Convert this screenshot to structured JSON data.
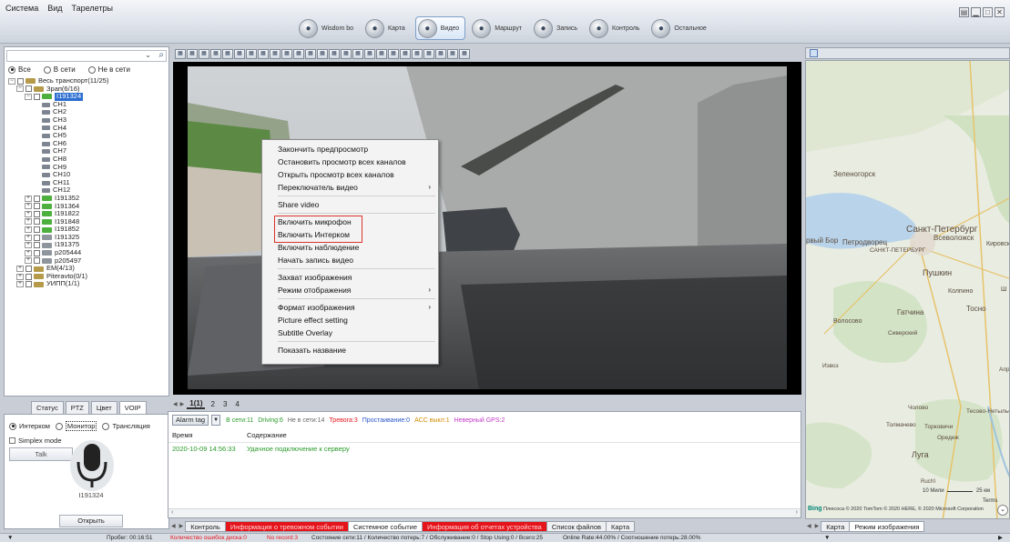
{
  "menu": [
    "Система",
    "Вид",
    "Тарелетры"
  ],
  "nav": [
    {
      "label": "Wisdom bo",
      "icon": "wisdom-icon",
      "active": false
    },
    {
      "label": "Карта",
      "icon": "map-icon",
      "active": false
    },
    {
      "label": "Видео",
      "icon": "video-icon",
      "active": true
    },
    {
      "label": "Маршрут",
      "icon": "route-icon",
      "active": false
    },
    {
      "label": "Запись",
      "icon": "record-icon",
      "active": false
    },
    {
      "label": "Контроль",
      "icon": "control-icon",
      "active": false
    },
    {
      "label": "Остальное",
      "icon": "other-icon",
      "active": false
    }
  ],
  "filter": {
    "all": "Все",
    "online": "В сети",
    "offline": "Не в сети"
  },
  "tree": [
    {
      "indent": 0,
      "exp": "−",
      "kind": "grp",
      "label": "Весь транспорт(11/25)"
    },
    {
      "indent": 1,
      "exp": "−",
      "kind": "grp",
      "label": "Зрап(6/16)"
    },
    {
      "indent": 2,
      "exp": "−",
      "kind": "grn",
      "label": "I191324",
      "selected": true
    },
    {
      "indent": 3,
      "exp": "",
      "kind": "cam",
      "label": "CH1"
    },
    {
      "indent": 3,
      "exp": "",
      "kind": "cam",
      "label": "CH2"
    },
    {
      "indent": 3,
      "exp": "",
      "kind": "cam",
      "label": "CH3"
    },
    {
      "indent": 3,
      "exp": "",
      "kind": "cam",
      "label": "CH4"
    },
    {
      "indent": 3,
      "exp": "",
      "kind": "cam",
      "label": "CH5"
    },
    {
      "indent": 3,
      "exp": "",
      "kind": "cam",
      "label": "CH6"
    },
    {
      "indent": 3,
      "exp": "",
      "kind": "cam",
      "label": "CH7"
    },
    {
      "indent": 3,
      "exp": "",
      "kind": "cam",
      "label": "CH8"
    },
    {
      "indent": 3,
      "exp": "",
      "kind": "cam",
      "label": "CH9"
    },
    {
      "indent": 3,
      "exp": "",
      "kind": "cam",
      "label": "CH10"
    },
    {
      "indent": 3,
      "exp": "",
      "kind": "cam",
      "label": "CH11"
    },
    {
      "indent": 3,
      "exp": "",
      "kind": "cam",
      "label": "CH12"
    },
    {
      "indent": 2,
      "exp": "+",
      "kind": "grn",
      "label": "I191352"
    },
    {
      "indent": 2,
      "exp": "+",
      "kind": "grn",
      "label": "I191364"
    },
    {
      "indent": 2,
      "exp": "+",
      "kind": "grn",
      "label": "I191822"
    },
    {
      "indent": 2,
      "exp": "+",
      "kind": "grn",
      "label": "I191848"
    },
    {
      "indent": 2,
      "exp": "+",
      "kind": "grn",
      "label": "I191852"
    },
    {
      "indent": 2,
      "exp": "+",
      "kind": "gry",
      "label": "I191325"
    },
    {
      "indent": 2,
      "exp": "+",
      "kind": "gry",
      "label": "I191375"
    },
    {
      "indent": 2,
      "exp": "+",
      "kind": "gry",
      "label": "p205444"
    },
    {
      "indent": 2,
      "exp": "+",
      "kind": "gry",
      "label": "p205497"
    },
    {
      "indent": 1,
      "exp": "+",
      "kind": "grp",
      "label": "EM(4/13)"
    },
    {
      "indent": 1,
      "exp": "+",
      "kind": "grp",
      "label": "Piteravto(0/1)"
    },
    {
      "indent": 1,
      "exp": "+",
      "kind": "grp",
      "label": "УИПП(1/1)"
    }
  ],
  "left_tabs": [
    "Статус",
    "PTZ",
    "Цвет",
    "VOIP"
  ],
  "voip": {
    "intercom": "Интерком",
    "monitor": "Монитор",
    "broadcast": "Трансляция",
    "simplex": "Simplex mode",
    "talk": "Talk",
    "device": "I191324",
    "open": "Открыть"
  },
  "context_menu": [
    {
      "label": "Закончить предпросмотр"
    },
    {
      "label": "Остановить просмотр всех каналов"
    },
    {
      "label": "Открыть просмотр всех каналов"
    },
    {
      "label": "Переключатель видео",
      "submenu": true
    },
    {
      "sep": true
    },
    {
      "label": "Share video"
    },
    {
      "sep": true
    },
    {
      "label": "Включить микрофон",
      "highlight": true
    },
    {
      "label": "Включить Интерком",
      "highlight": true
    },
    {
      "label": "Включить наблюдение"
    },
    {
      "label": "Начать запись видео"
    },
    {
      "sep": true
    },
    {
      "label": "Захват изображения"
    },
    {
      "label": "Режим отображения",
      "submenu": true
    },
    {
      "sep": true
    },
    {
      "label": "Формат изображения",
      "submenu": true
    },
    {
      "label": "Picture effect setting"
    },
    {
      "label": "Subtitle Overlay"
    },
    {
      "sep": true
    },
    {
      "label": "Показать название"
    }
  ],
  "page_tabs": [
    "1(1)",
    "2",
    "3",
    "4"
  ],
  "log": {
    "alarm_tag": "Alarm tag",
    "stats": [
      {
        "text": "В сети:11",
        "color": "#2b9a2b"
      },
      {
        "text": "Driving:6",
        "color": "#2b9a2b"
      },
      {
        "text": "Не в сети:14",
        "color": "#666666"
      },
      {
        "text": "Тревога:3",
        "color": "#e5141b"
      },
      {
        "text": "Простаивание:0",
        "color": "#2b56c8"
      },
      {
        "text": "ACC выкл:1",
        "color": "#d18a00"
      },
      {
        "text": "Неверный GPS:2",
        "color": "#c23ac8"
      }
    ],
    "col_time": "Время",
    "col_content": "Содержание",
    "row_time": "2020-10-09 14:56:33",
    "row_content": "Удачное подключение к серверу"
  },
  "bottom_tabs": [
    {
      "label": "Контроль",
      "red": false
    },
    {
      "label": "Информация о тревожном событии",
      "red": true
    },
    {
      "label": "Системное событие",
      "red": false,
      "active": true
    },
    {
      "label": "Информация об отчетах устройства",
      "red": true
    },
    {
      "label": "Список файлов",
      "red": false
    },
    {
      "label": "Карта",
      "red": false
    }
  ],
  "map": {
    "labels": [
      "Зеленогорск",
      "Всеволожск",
      "Петродворец",
      "Санкт-Петербург",
      "САНКТ-ПЕТЕРБУРГ",
      "Кировск",
      "Колпино",
      "Пушкин",
      "Гатчина",
      "Тосно",
      "Волосово",
      "Сиверский",
      "Извоз",
      "Чолово",
      "Тесово-Нетыльский",
      "Толмачево",
      "Торковичи",
      "Оредеж",
      "Луга",
      "Ruch'i",
      "Ш",
      "Апр"
    ],
    "left_label": "рвый Бор",
    "scale_metric": "10 Мили",
    "scale_km": "25 км",
    "copyright": "© 2020 TomTom © 2020 HERE, © 2020 Microsoft Corporation",
    "provider": "Bing",
    "zoom_hint": "Плюсоса",
    "terms": "Terms"
  },
  "map_tabs": [
    "Карта",
    "Режим изображения"
  ],
  "status": {
    "mileage": "Пробег: 00:16:51",
    "disk_errors": "Количество ошибок диска:0",
    "no_record": "No record:3",
    "state": "Состояние сети:11 / Количество потерь:7 / Обслуживание:0 / Stop Using:0 / Всего:25",
    "rate": "Online Rate:44.00% / Соотношение потерь:28.00%"
  }
}
